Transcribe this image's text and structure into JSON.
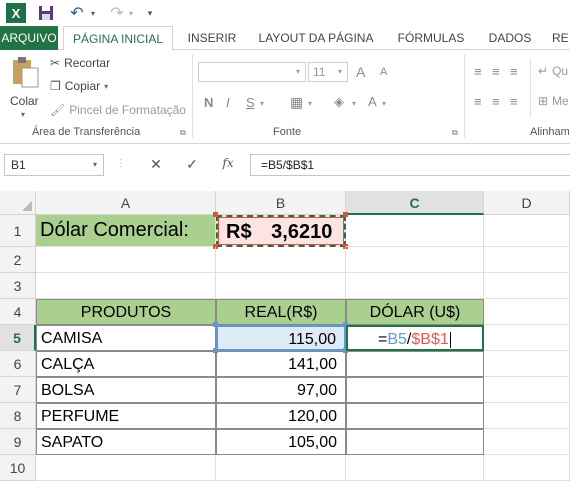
{
  "qat": {
    "app_logo": "X",
    "save_icon": "save-icon",
    "undo_icon": "↶",
    "redo_icon": "↷",
    "dropdown": "▾",
    "customize": "▾"
  },
  "tabs": [
    "ARQUIVO",
    "PÁGINA INICIAL",
    "INSERIR",
    "LAYOUT DA PÁGINA",
    "FÓRMULAS",
    "DADOS",
    "RE"
  ],
  "ribbon": {
    "clipboard": {
      "paste_label": "Colar",
      "cut_label": "Recortar",
      "copy_label": "Copiar",
      "format_painter_label": "Pincel de Formatação",
      "group_label": "Área de Transferência"
    },
    "font": {
      "font_size": "11",
      "grow_label": "A",
      "shrink_label": "A",
      "bold": "N",
      "italic": "I",
      "underline": "S",
      "font_color_label": "A",
      "group_label": "Fonte"
    },
    "alignment": {
      "wrap_label": "Qu",
      "merge_label": "Me",
      "group_label": "Alinham"
    }
  },
  "formula_bar": {
    "name_box": "B1",
    "cancel": "✕",
    "enter": "✓",
    "fx": "fx",
    "formula": "=B5/$B$1"
  },
  "grid": {
    "columns": [
      "A",
      "B",
      "C",
      "D"
    ],
    "rows": [
      "1",
      "2",
      "3",
      "4",
      "5",
      "6",
      "7",
      "8",
      "9",
      "10"
    ],
    "a1": "Dólar Comercial:",
    "b1_currency": "R$",
    "b1_value": "3,6210",
    "headers": {
      "a4": "PRODUTOS",
      "b4": "REAL(R$)",
      "c4": "DÓLAR (U$)"
    },
    "products": [
      {
        "name": "CAMISA",
        "real": "115,00"
      },
      {
        "name": "CALÇA",
        "real": "141,00"
      },
      {
        "name": "BOLSA",
        "real": "97,00"
      },
      {
        "name": "PERFUME",
        "real": "120,00"
      },
      {
        "name": "SAPATO",
        "real": "105,00"
      }
    ],
    "c5_formula": {
      "eq": "=",
      "ref1": "B5",
      "op": "/",
      "ref2": "$B$1"
    }
  },
  "colors": {
    "excel_green": "#217346",
    "header_fill": "#a9d08e",
    "b1_fill": "#fce4e4",
    "ref_blue": "#5b9bd5",
    "ref_red": "#e05a5a"
  }
}
